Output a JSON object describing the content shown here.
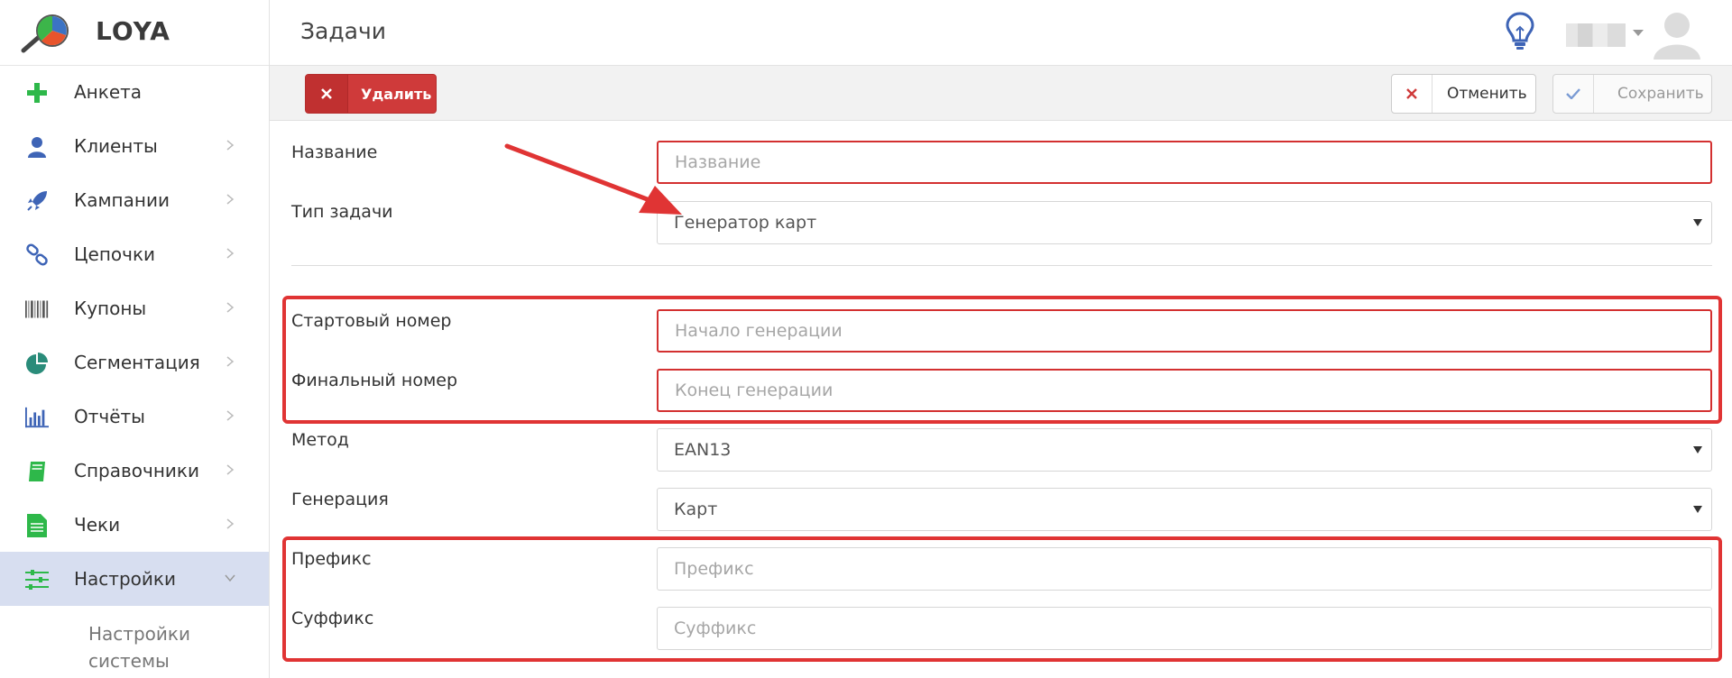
{
  "app": {
    "brand": "LOYA",
    "page_title": "Задачи"
  },
  "sidebar": {
    "items": [
      {
        "key": "anketa",
        "label": "Анкета",
        "icon": "plus-icon",
        "has_chevron": false
      },
      {
        "key": "clients",
        "label": "Клиенты",
        "icon": "user-icon",
        "has_chevron": true
      },
      {
        "key": "campaigns",
        "label": "Кампании",
        "icon": "rocket-icon",
        "has_chevron": true
      },
      {
        "key": "chains",
        "label": "Цепочки",
        "icon": "link-icon",
        "has_chevron": true
      },
      {
        "key": "coupons",
        "label": "Купоны",
        "icon": "barcode-icon",
        "has_chevron": true
      },
      {
        "key": "segmentation",
        "label": "Сегментация",
        "icon": "pie-chart-icon",
        "has_chevron": true
      },
      {
        "key": "reports",
        "label": "Отчёты",
        "icon": "bar-chart-icon",
        "has_chevron": true
      },
      {
        "key": "references",
        "label": "Справочники",
        "icon": "book-icon",
        "has_chevron": true
      },
      {
        "key": "receipts",
        "label": "Чеки",
        "icon": "document-icon",
        "has_chevron": true
      },
      {
        "key": "settings",
        "label": "Настройки",
        "icon": "sliders-icon",
        "has_chevron": true,
        "active": true,
        "expanded": true
      }
    ],
    "sub_item": "Настройки системы"
  },
  "toolbar": {
    "delete_label": "Удалить",
    "cancel_label": "Отменить",
    "save_label": "Сохранить"
  },
  "form": {
    "name_label": "Название",
    "name_placeholder": "Название",
    "task_type_label": "Тип задачи",
    "task_type_value": "Генератор карт",
    "start_label": "Стартовый номер",
    "start_placeholder": "Начало генерации",
    "end_label": "Финальный номер",
    "end_placeholder": "Конец генерации",
    "method_label": "Метод",
    "method_value": "EAN13",
    "generation_label": "Генерация",
    "generation_value": "Карт",
    "prefix_label": "Префикс",
    "prefix_placeholder": "Префикс",
    "suffix_label": "Суффикс",
    "suffix_placeholder": "Суффикс"
  },
  "colors": {
    "accent_green": "#2eb84a",
    "danger": "#cf3a3a",
    "annotation": "#e03434",
    "active_nav": "#d7def0",
    "icon_blue": "#3e64b6"
  }
}
